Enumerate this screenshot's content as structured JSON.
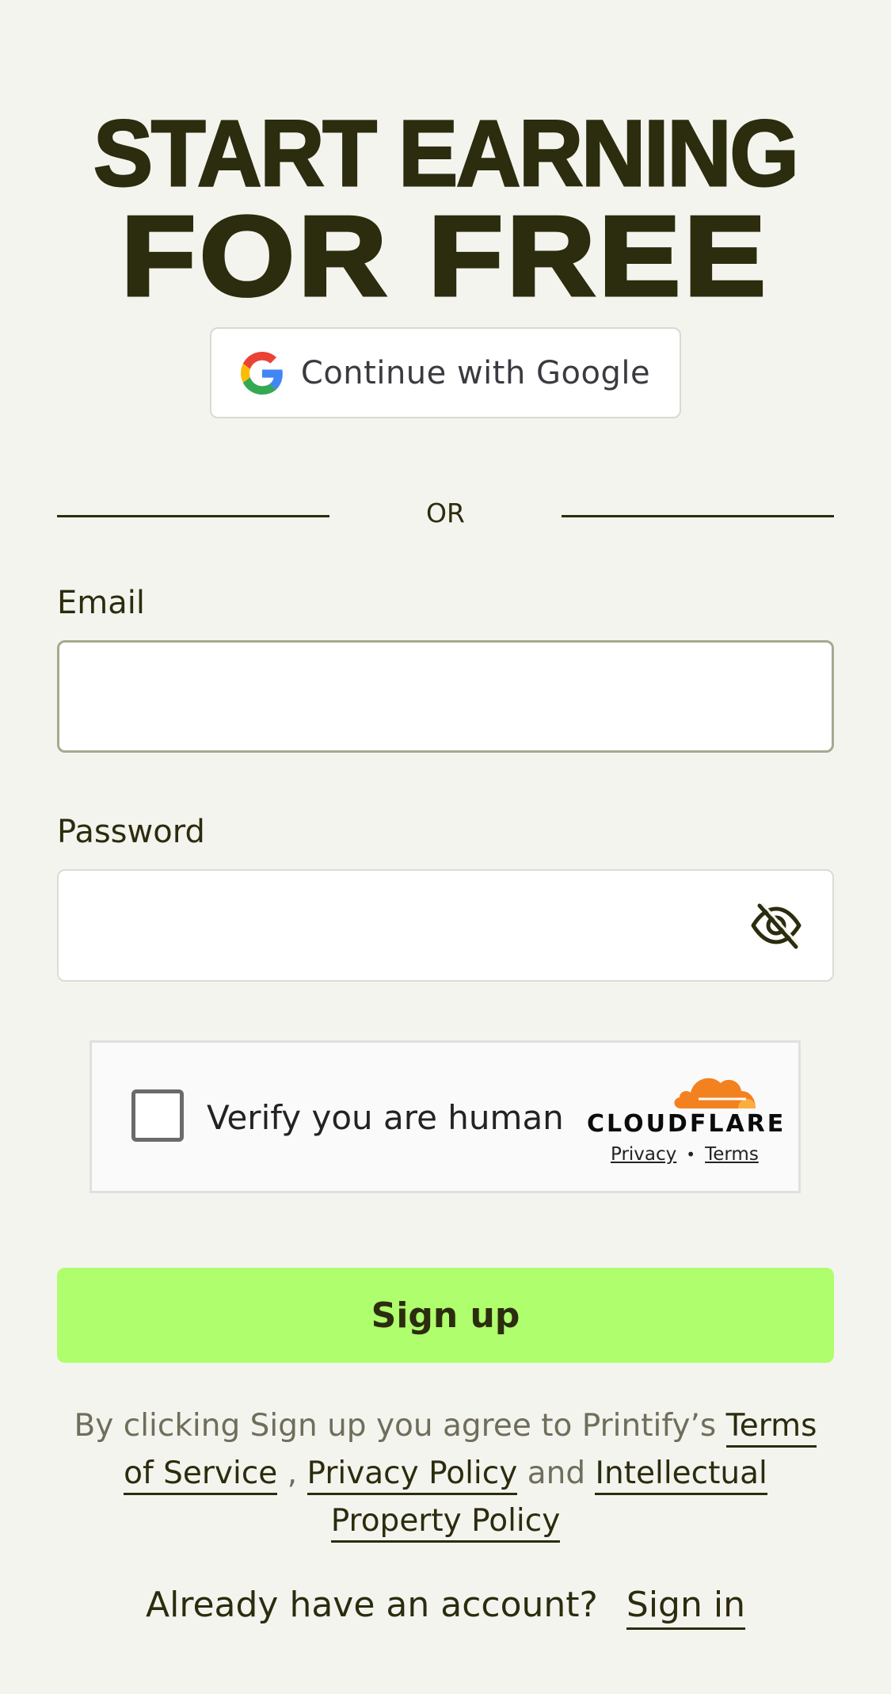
{
  "headline": {
    "line1": "START EARNING",
    "line2": "FOR FREE"
  },
  "google_button": {
    "label": "Continue with Google",
    "icon": "google-logo-icon"
  },
  "divider": {
    "text": "OR"
  },
  "email": {
    "label": "Email",
    "value": "",
    "placeholder": ""
  },
  "password": {
    "label": "Password",
    "value": "",
    "placeholder": "",
    "toggle_icon": "eye-slash-icon"
  },
  "captcha": {
    "label": "Verify you are human",
    "brand": "CLOUDFLARE",
    "privacy": "Privacy",
    "separator": "•",
    "terms": "Terms"
  },
  "signup_button": {
    "label": "Sign up"
  },
  "legal": {
    "prefix": "By clicking Sign up you agree to Printify’s",
    "terms_link": "Terms of Service",
    "comma": ",",
    "privacy_link": "Privacy Policy",
    "and": "and",
    "ip_link": "Intellectual Property Policy"
  },
  "signin": {
    "prompt": "Already have an account?",
    "link": "Sign in"
  },
  "colors": {
    "background": "#f4f4ef",
    "text_dark": "#2c2c0e",
    "signup_green": "#aefe6e",
    "cloudflare_orange": "#f48120"
  }
}
